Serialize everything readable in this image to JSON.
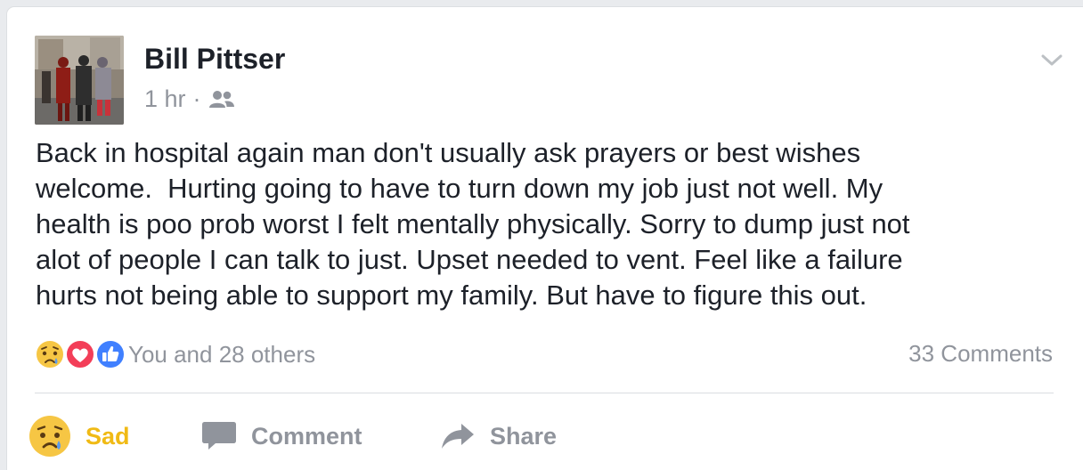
{
  "post": {
    "author": "Bill Pittser",
    "time": "1 hr",
    "separator": "·",
    "audience_icon": "friends-icon",
    "text": "Back in hospital again man don't usually ask prayers or best wishes\nwelcome.  Hurting going to have to turn down my job just not well. My\nhealth is poo prob worst I felt mentally physically. Sorry to dump just not\nalot of people I can talk to just. Upset needed to vent. Feel like a failure\nhurts not being able to support my family. But have to figure this out."
  },
  "reactions": {
    "icons": [
      "sad-reaction-icon",
      "love-reaction-icon",
      "like-reaction-icon"
    ],
    "summary": "You and 28 others",
    "comments": "33 Comments"
  },
  "actions": {
    "sad_label": "Sad",
    "comment_label": "Comment",
    "share_label": "Share"
  },
  "colors": {
    "sad": "#f0ba15",
    "love": "#f33e58",
    "like": "#4080ff",
    "secondary_text": "#90949c"
  }
}
